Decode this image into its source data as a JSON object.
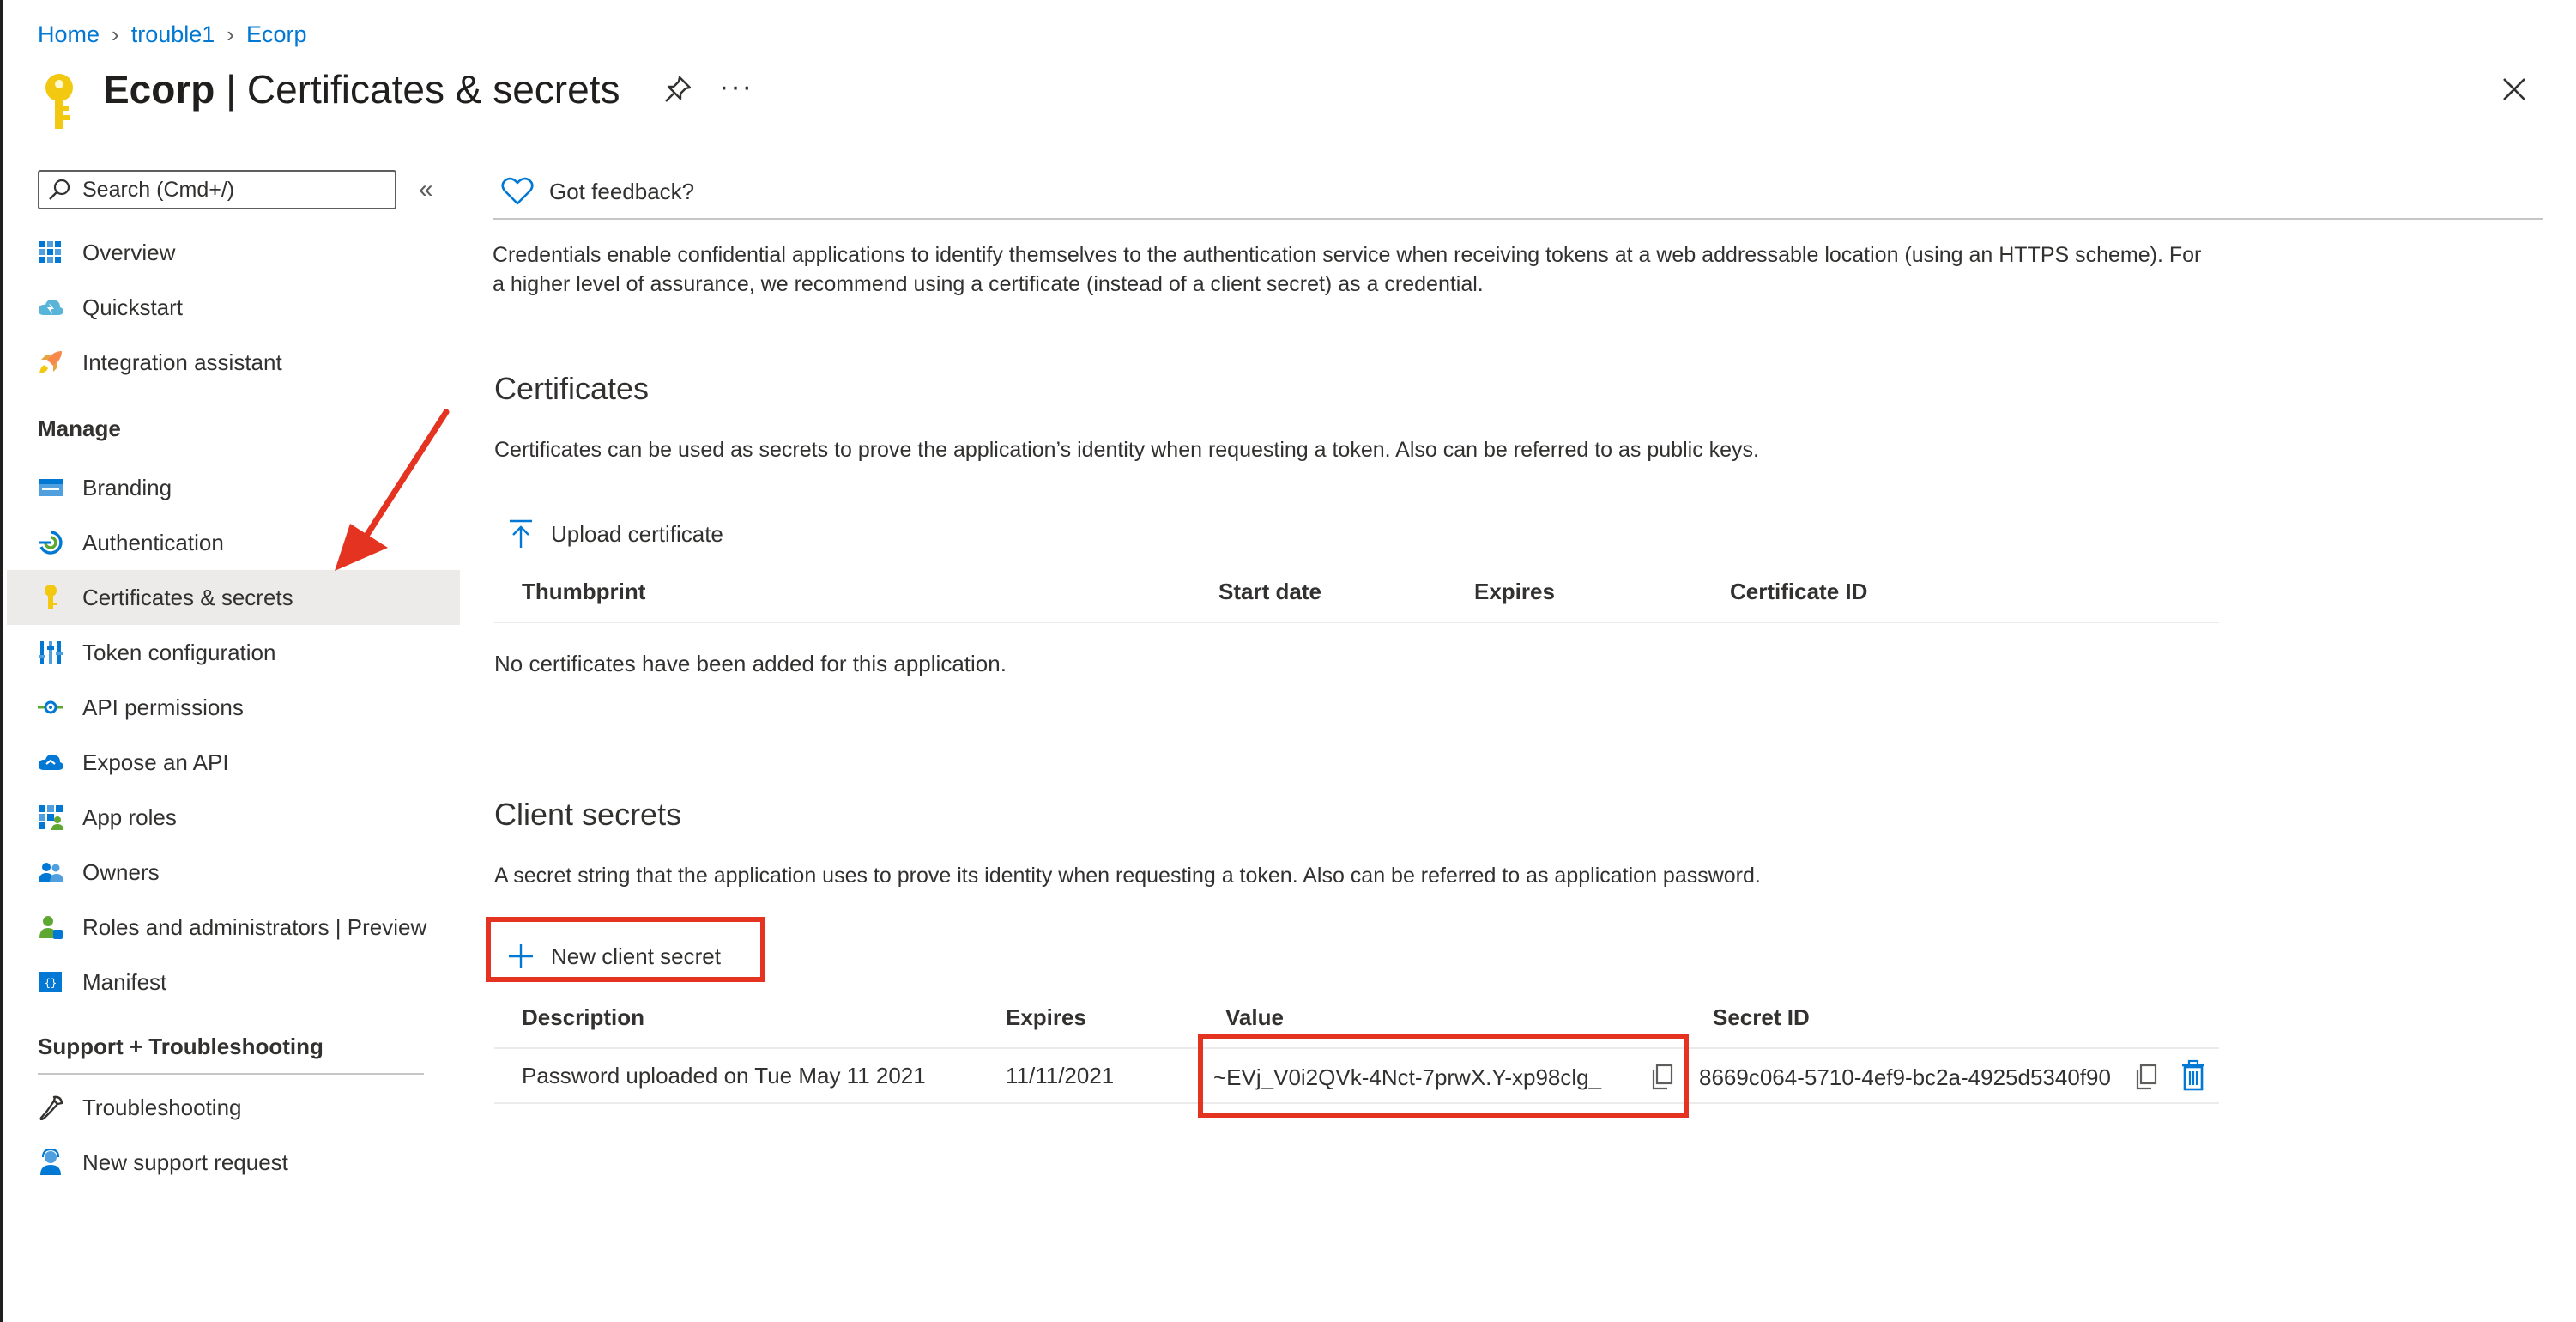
{
  "breadcrumb": [
    "Home",
    "trouble1",
    "Ecorp"
  ],
  "page_title": {
    "app": "Ecorp",
    "separator": " | ",
    "section": "Certificates & secrets"
  },
  "header": {
    "more_label": "···"
  },
  "colors": {
    "accent": "#0078d4",
    "highlight_red": "#e53321",
    "selected_bg": "#edebe9",
    "key_gold": "#f2c811"
  },
  "sidebar": {
    "search_placeholder": "Search (Cmd+/)",
    "collapse_label": "«",
    "items": [
      {
        "label": "Overview",
        "icon": "overview-grid-icon"
      },
      {
        "label": "Quickstart",
        "icon": "quickstart-cloud-icon"
      },
      {
        "label": "Integration assistant",
        "icon": "rocket-icon"
      }
    ],
    "manage_header": "Manage",
    "manage_items": [
      {
        "label": "Branding",
        "icon": "branding-icon"
      },
      {
        "label": "Authentication",
        "icon": "authentication-icon"
      },
      {
        "label": "Certificates & secrets",
        "icon": "key-icon",
        "selected": true
      },
      {
        "label": "Token configuration",
        "icon": "token-bars-icon"
      },
      {
        "label": "API permissions",
        "icon": "api-permissions-icon"
      },
      {
        "label": "Expose an API",
        "icon": "expose-api-cloud-icon"
      },
      {
        "label": "App roles",
        "icon": "app-roles-icon"
      },
      {
        "label": "Owners",
        "icon": "owners-icon"
      },
      {
        "label": "Roles and administrators | Preview",
        "icon": "roles-admins-icon"
      },
      {
        "label": "Manifest",
        "icon": "manifest-icon"
      }
    ],
    "support_header": "Support + Troubleshooting",
    "support_items": [
      {
        "label": "Troubleshooting",
        "icon": "wrench-icon"
      },
      {
        "label": "New support request",
        "icon": "support-person-icon"
      }
    ]
  },
  "content": {
    "feedback_label": "Got feedback?",
    "description": "Credentials enable confidential applications to identify themselves to the authentication service when receiving tokens at a web addressable location (using an HTTPS scheme). For a higher level of assurance, we recommend using a certificate (instead of a client secret) as a credential.",
    "certificates": {
      "title": "Certificates",
      "description": "Certificates can be used as secrets to prove the application’s identity when requesting a token. Also can be referred to as public keys.",
      "upload_label": "Upload certificate",
      "columns": [
        "Thumbprint",
        "Start date",
        "Expires",
        "Certificate ID"
      ],
      "empty_message": "No certificates have been added for this application."
    },
    "client_secrets": {
      "title": "Client secrets",
      "description": "A secret string that the application uses to prove its identity when requesting a token. Also can be referred to as application password.",
      "new_label": "New client secret",
      "columns": [
        "Description",
        "Expires",
        "Value",
        "Secret ID"
      ],
      "rows": [
        {
          "description": "Password uploaded on Tue May 11 2021",
          "expires": "11/11/2021",
          "value": "~EVj_V0i2QVk-4Nct-7prwX.Y-xp98clg_",
          "secret_id": "8669c064-5710-4ef9-bc2a-4925d5340f90"
        }
      ]
    }
  }
}
